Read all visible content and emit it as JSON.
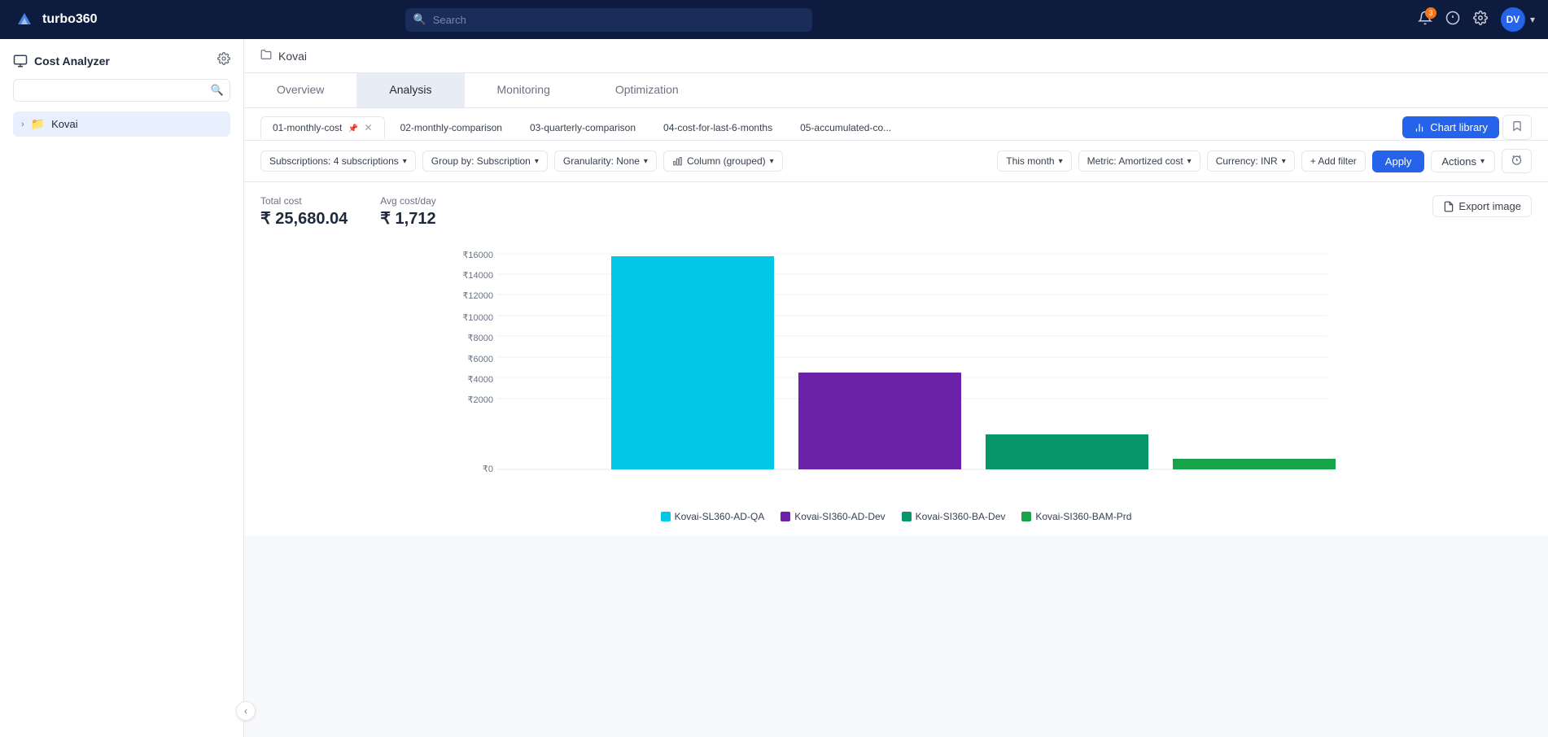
{
  "app": {
    "name": "turbo360"
  },
  "topnav": {
    "search_placeholder": "Search",
    "badge_count": "3",
    "user_initials": "DV"
  },
  "sidebar": {
    "title": "Cost Analyzer",
    "search_placeholder": "",
    "items": [
      {
        "label": "Kovai",
        "icon": "folder"
      }
    ]
  },
  "breadcrumb": {
    "label": "Kovai"
  },
  "main_tabs": [
    {
      "id": "overview",
      "label": "Overview"
    },
    {
      "id": "analysis",
      "label": "Analysis",
      "active": true
    },
    {
      "id": "monitoring",
      "label": "Monitoring"
    },
    {
      "id": "optimization",
      "label": "Optimization"
    }
  ],
  "chart_tabs": [
    {
      "id": "tab1",
      "label": "01-monthly-cost",
      "active": true,
      "pinned": true,
      "closable": true
    },
    {
      "id": "tab2",
      "label": "02-monthly-comparison"
    },
    {
      "id": "tab3",
      "label": "03-quarterly-comparison"
    },
    {
      "id": "tab4",
      "label": "04-cost-for-last-6-months"
    },
    {
      "id": "tab5",
      "label": "05-accumulated-co..."
    }
  ],
  "buttons": {
    "chart_library": "Chart library",
    "apply": "Apply",
    "actions": "Actions",
    "add_filter": "+ Add filter",
    "export_image": "Export image"
  },
  "filters": {
    "subscriptions": "Subscriptions: 4 subscriptions",
    "group_by": "Group by: Subscription",
    "granularity": "Granularity: None",
    "chart_type": "Column (grouped)",
    "time_period": "This month",
    "metric": "Metric: Amortized cost",
    "currency": "Currency: INR"
  },
  "cost_summary": {
    "total_cost_label": "Total cost",
    "total_cost_value": "₹ 25,680.04",
    "avg_cost_label": "Avg cost/day",
    "avg_cost_value": "₹ 1,712"
  },
  "chart": {
    "y_axis_labels": [
      "₹16000",
      "₹14000",
      "₹12000",
      "₹10000",
      "₹8000",
      "₹6000",
      "₹4000",
      "₹2000",
      "₹0"
    ],
    "bars": [
      {
        "label": "Kovai-SL360-AD-QA",
        "color": "#00c8e6",
        "value": 15000
      },
      {
        "label": "Kovai-SI360-AD-Dev",
        "color": "#6b21a8",
        "value": 7200
      },
      {
        "label": "Kovai-SI360-BA-Dev",
        "color": "#059669",
        "value": 2600
      },
      {
        "label": "Kovai-SI360-BAM-Prd",
        "color": "#16a34a",
        "value": 800
      }
    ],
    "max_value": 16000
  },
  "legend": [
    {
      "label": "Kovai-SL360-AD-QA",
      "color": "#00c8e6"
    },
    {
      "label": "Kovai-SI360-AD-Dev",
      "color": "#6b21a8"
    },
    {
      "label": "Kovai-SI360-BA-Dev",
      "color": "#059669"
    },
    {
      "label": "Kovai-SI360-BAM-Prd",
      "color": "#16a34a"
    }
  ]
}
